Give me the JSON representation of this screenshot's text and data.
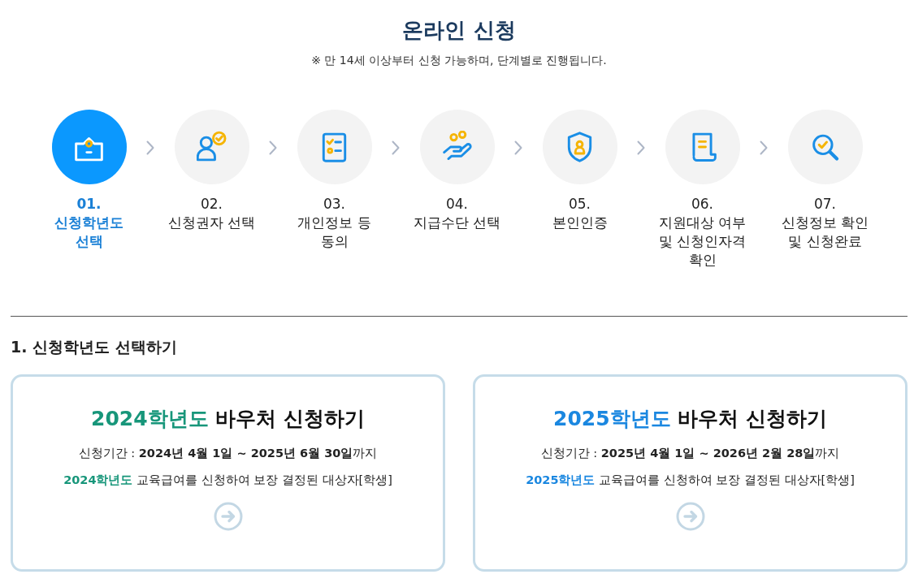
{
  "header": {
    "title": "온라인 신청",
    "notice": "※ 만 14세 이상부터 신청 가능하며, 단계별로 진행됩니다."
  },
  "steps": [
    {
      "number": "01.",
      "label": "신청학년도 선택",
      "selected": true
    },
    {
      "number": "02.",
      "label": "신청권자 선택",
      "selected": false
    },
    {
      "number": "03.",
      "label": "개인정보 등 동의",
      "selected": false
    },
    {
      "number": "04.",
      "label": "지급수단 선택",
      "selected": false
    },
    {
      "number": "05.",
      "label": "본인인증",
      "selected": false
    },
    {
      "number": "06.",
      "label": "지원대상 여부 및 신청인자격 확인",
      "selected": false
    },
    {
      "number": "07.",
      "label": "신청정보 확인 및 신청완료",
      "selected": false
    }
  ],
  "section": {
    "title": "1. 신청학년도 선택하기"
  },
  "cards": [
    {
      "title_year": "2024학년도",
      "title": "바우처 신청하기",
      "color": "#17967a",
      "period": "신청기간 : **2024년 4월 1일 ~ 2025년 6월 30일**까지",
      "description_year": "2024학년도",
      "description": "교육급여를 신청하여 보장 결정된 대상자[학생]"
    },
    {
      "title_year": "2025학년도",
      "title": "바우처 신청하기",
      "color": "#1a87e0",
      "period": "신청기간 : **2025년 4월 1일 ~ 2026년 2월 28일**까지",
      "description_year": "2025학년도",
      "description": "교육급여를 신청하여 보장 결정된 대상자[학생]"
    }
  ]
}
